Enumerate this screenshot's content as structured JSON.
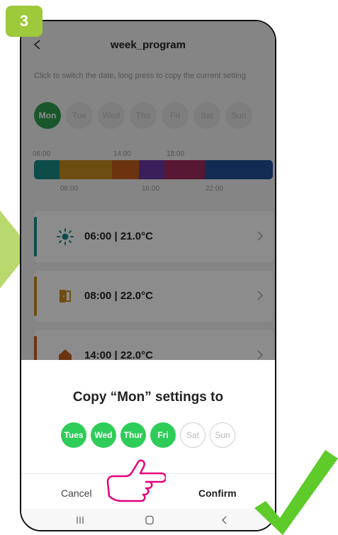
{
  "step_badge": "3",
  "header": {
    "title": "week_program"
  },
  "hint": "Click to switch the date, long press to copy the current setting",
  "days": [
    {
      "label": "Mon",
      "selected": true
    },
    {
      "label": "Tue",
      "selected": false
    },
    {
      "label": "Wed",
      "selected": false
    },
    {
      "label": "Thu",
      "selected": false
    },
    {
      "label": "Fri",
      "selected": false
    },
    {
      "label": "Sat",
      "selected": false
    },
    {
      "label": "Sun",
      "selected": false
    }
  ],
  "timeline": {
    "top_labels": [
      "06:00",
      "14:00",
      "18:00"
    ],
    "bottom_labels": [
      "08:00",
      "16:00",
      "22:00"
    ],
    "colors": [
      "#1a8a87",
      "#c88c22",
      "#c35f1c",
      "#6a3aa5",
      "#a02a5b",
      "#1f4f96"
    ]
  },
  "schedule": [
    {
      "time_temp": "06:00  |  21.0°C",
      "icon": "sun-icon",
      "color": "#1a8a87"
    },
    {
      "time_temp": "08:00  |  22.0°C",
      "icon": "door-icon",
      "color": "#c88c22"
    },
    {
      "time_temp": "14:00  |  22.0°C",
      "icon": "home-icon",
      "color": "#c35f1c"
    }
  ],
  "sheet": {
    "title": "Copy “Mon” settings to",
    "chips": [
      {
        "label": "Tues",
        "checked": true
      },
      {
        "label": "Wed",
        "checked": true
      },
      {
        "label": "Thur",
        "checked": true
      },
      {
        "label": "Fri",
        "checked": true
      },
      {
        "label": "Sat",
        "checked": false
      },
      {
        "label": "Sun",
        "checked": false
      }
    ],
    "cancel": "Cancel",
    "confirm": "Confirm"
  },
  "colors": {
    "accent_green": "#2ecc58",
    "badge_green": "#9dc93b",
    "check_green": "#5ecb2b",
    "hand_pink": "#e6007e"
  }
}
